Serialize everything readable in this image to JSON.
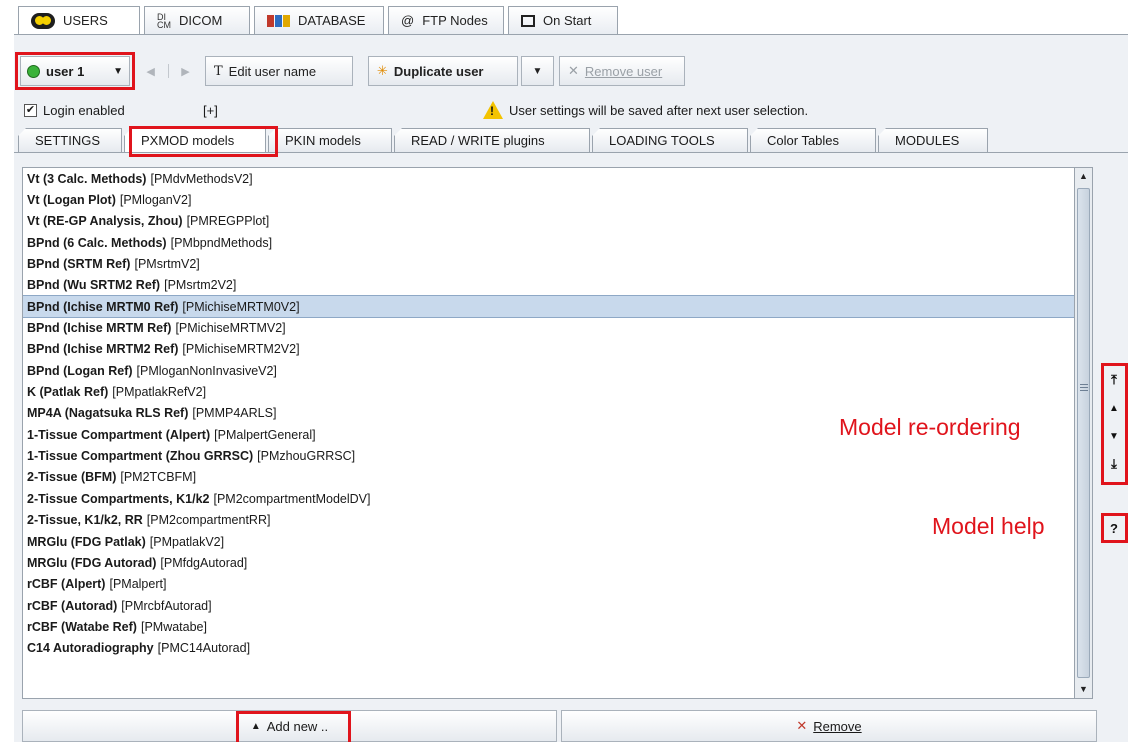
{
  "top_tabs": [
    {
      "label": "USERS",
      "icon": "users-icon"
    },
    {
      "label": "DICOM",
      "icon": "dicom-icon"
    },
    {
      "label": "DATABASE",
      "icon": "database-icon"
    },
    {
      "label": "FTP Nodes",
      "icon": "at-icon"
    },
    {
      "label": "On Start",
      "icon": "window-icon"
    }
  ],
  "toolbar": {
    "user_value": "user 1",
    "edit_label": "Edit user name",
    "duplicate_label": "Duplicate user",
    "remove_label": "Remove user"
  },
  "status": {
    "login_label": "Login enabled",
    "expand_label": "[+]",
    "warning_text": "User settings will be saved after next user selection."
  },
  "sub_tabs": [
    "SETTINGS",
    "PXMOD models",
    "PKIN models",
    "READ / WRITE plugins",
    "LOADING TOOLS",
    "Color Tables",
    "MODULES"
  ],
  "models": [
    {
      "name": "Vt (3 Calc. Methods)",
      "code": "[PMdvMethodsV2]"
    },
    {
      "name": "Vt (Logan Plot)",
      "code": "[PMloganV2]"
    },
    {
      "name": "Vt (RE-GP Analysis, Zhou)",
      "code": "[PMREGPPlot]"
    },
    {
      "name": "BPnd (6 Calc. Methods)",
      "code": "[PMbpndMethods]"
    },
    {
      "name": "BPnd (SRTM Ref)",
      "code": "[PMsrtmV2]"
    },
    {
      "name": "BPnd (Wu SRTM2 Ref)",
      "code": "[PMsrtm2V2]"
    },
    {
      "name": "BPnd (Ichise MRTM0 Ref)",
      "code": "[PMichiseMRTM0V2]"
    },
    {
      "name": "BPnd (Ichise MRTM Ref)",
      "code": "[PMichiseMRTMV2]"
    },
    {
      "name": "BPnd (Ichise MRTM2 Ref)",
      "code": "[PMichiseMRTM2V2]"
    },
    {
      "name": "BPnd (Logan Ref)",
      "code": "[PMloganNonInvasiveV2]"
    },
    {
      "name": "K (Patlak Ref)",
      "code": "[PMpatlakRefV2]"
    },
    {
      "name": "MP4A (Nagatsuka RLS Ref)",
      "code": "[PMMP4ARLS]"
    },
    {
      "name": "1-Tissue Compartment (Alpert)",
      "code": "[PMalpertGeneral]"
    },
    {
      "name": "1-Tissue Compartment (Zhou GRRSC)",
      "code": "[PMzhouGRRSC]"
    },
    {
      "name": "2-Tissue (BFM)",
      "code": "[PM2TCBFM]"
    },
    {
      "name": "2-Tissue Compartments, K1/k2",
      "code": "[PM2compartmentModelDV]"
    },
    {
      "name": "2-Tissue, K1/k2, RR",
      "code": "[PM2compartmentRR]"
    },
    {
      "name": "MRGlu (FDG Patlak)",
      "code": "[PMpatlakV2]"
    },
    {
      "name": "MRGlu (FDG Autorad)",
      "code": "[PMfdgAutorad]"
    },
    {
      "name": "rCBF (Alpert)",
      "code": "[PMalpert]"
    },
    {
      "name": "rCBF (Autorad)",
      "code": "[PMrcbfAutorad]"
    },
    {
      "name": "rCBF (Watabe Ref)",
      "code": "[PMwatabe]"
    },
    {
      "name": "C14 Autoradiography",
      "code": "[PMC14Autorad]"
    }
  ],
  "selected_index": 6,
  "annotations": {
    "reorder": "Model re-ordering",
    "help": "Model help"
  },
  "side": {
    "help_label": "?"
  },
  "bottom": {
    "add_label": "Add new ..",
    "remove_label": "Remove"
  },
  "colors": {
    "highlight": "#e0141c",
    "selection": "#c8d9ec"
  }
}
